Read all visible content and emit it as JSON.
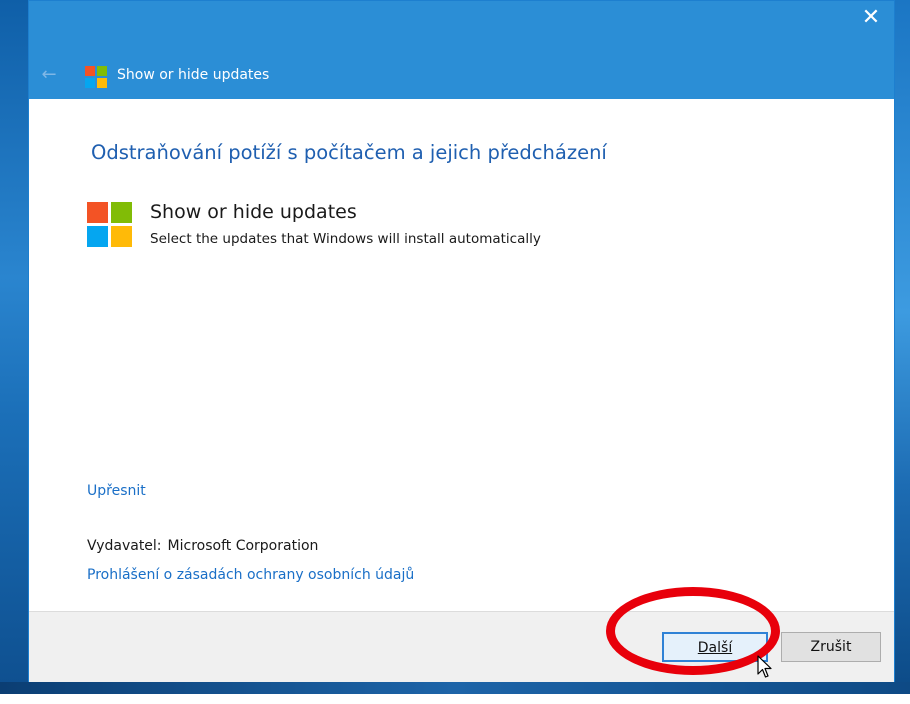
{
  "window": {
    "title": "Show or hide updates",
    "close_glyph": "✕",
    "back_glyph": "←"
  },
  "content": {
    "heading": "Odstraňování potíží s počítačem a jejich předcházení",
    "item_title": "Show or hide updates",
    "item_description": "Select the updates that Windows will install automatically",
    "advanced_link": "Upřesnit",
    "publisher_label": "Vydavatel:",
    "publisher_value": "Microsoft Corporation",
    "privacy_link": "Prohlášení o zásadách ochrany osobních údajů"
  },
  "footer": {
    "next_label": "Další",
    "cancel_label": "Zrušit"
  },
  "colors": {
    "titlebar": "#2b8ed6",
    "link": "#1a6fc7",
    "heading": "#1f5fb0",
    "highlight": "#e8000b",
    "logo_red": "#f35325",
    "logo_green": "#81bc06",
    "logo_blue": "#05a6f0",
    "logo_yellow": "#ffba08"
  },
  "icons": [
    "close-icon",
    "back-arrow-icon",
    "windows-logo-icon",
    "mouse-cursor-icon"
  ]
}
